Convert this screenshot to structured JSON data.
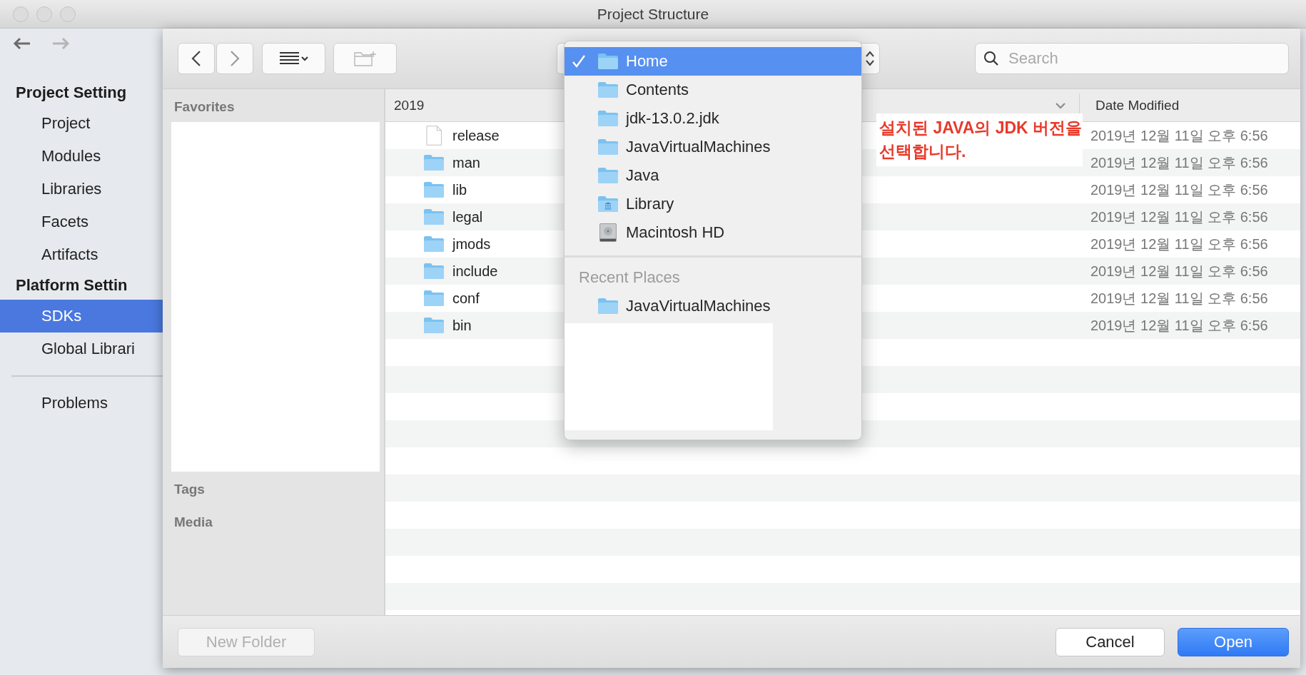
{
  "window": {
    "title": "Project Structure"
  },
  "sidebar": {
    "sections": [
      {
        "heading": "Project Setting",
        "items": [
          {
            "label": "Project",
            "selected": false
          },
          {
            "label": "Modules",
            "selected": false
          },
          {
            "label": "Libraries",
            "selected": false
          },
          {
            "label": "Facets",
            "selected": false
          },
          {
            "label": "Artifacts",
            "selected": false
          }
        ]
      },
      {
        "heading": "Platform Settin",
        "items": [
          {
            "label": "SDKs",
            "selected": true
          },
          {
            "label": "Global Librari",
            "selected": false
          }
        ]
      }
    ],
    "bottom_items": [
      {
        "label": "Problems",
        "selected": false
      }
    ]
  },
  "dialog": {
    "search": {
      "placeholder": "Search"
    },
    "favorites": {
      "heading": "Favorites",
      "sections": [
        "Tags",
        "Media"
      ]
    },
    "columns": [
      "2019",
      "Date Modified"
    ],
    "files": [
      {
        "name": "release",
        "kind": "file",
        "date_modified": "2019년 12월 11일 오후 6:56"
      },
      {
        "name": "man",
        "kind": "folder",
        "date_modified": "2019년 12월 11일 오후 6:56"
      },
      {
        "name": "lib",
        "kind": "folder",
        "date_modified": "2019년 12월 11일 오후 6:56"
      },
      {
        "name": "legal",
        "kind": "folder",
        "date_modified": "2019년 12월 11일 오후 6:56"
      },
      {
        "name": "jmods",
        "kind": "folder",
        "date_modified": "2019년 12월 11일 오후 6:56"
      },
      {
        "name": "include",
        "kind": "folder",
        "date_modified": "2019년 12월 11일 오후 6:56"
      },
      {
        "name": "conf",
        "kind": "folder",
        "date_modified": "2019년 12월 11일 오후 6:56"
      },
      {
        "name": "bin",
        "kind": "folder",
        "date_modified": "2019년 12월 11일 오후 6:56"
      }
    ],
    "path_menu": {
      "items": [
        {
          "label": "Home",
          "kind": "folder",
          "selected": true
        },
        {
          "label": "Contents",
          "kind": "folder",
          "selected": false
        },
        {
          "label": "jdk-13.0.2.jdk",
          "kind": "folder",
          "selected": false
        },
        {
          "label": "JavaVirtualMachines",
          "kind": "folder",
          "selected": false
        },
        {
          "label": "Java",
          "kind": "folder",
          "selected": false
        },
        {
          "label": "Library",
          "kind": "library",
          "selected": false
        },
        {
          "label": "Macintosh HD",
          "kind": "disk",
          "selected": false
        }
      ],
      "recent_heading": "Recent Places",
      "recent": [
        {
          "label": "JavaVirtualMachines",
          "kind": "folder",
          "selected": false
        }
      ]
    },
    "buttons": [
      {
        "label": "New Folder",
        "kind": "secondary",
        "disabled": true
      },
      {
        "label": "Cancel",
        "kind": "secondary",
        "disabled": false
      },
      {
        "label": "Open",
        "kind": "primary",
        "disabled": false
      }
    ]
  },
  "annotation": {
    "text": "설치된 JAVA의 JDK 버전을 선택합니다."
  }
}
